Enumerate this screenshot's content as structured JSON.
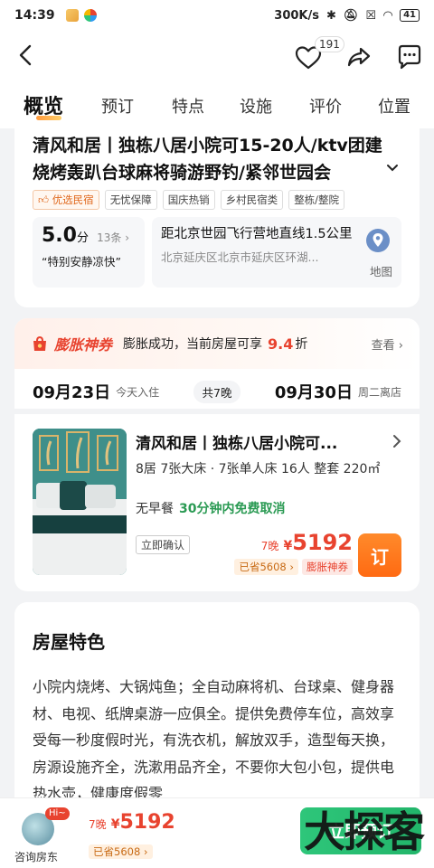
{
  "status": {
    "time": "14:39",
    "speed": "300K/s",
    "battery": "41"
  },
  "header": {
    "favorite_count": "191"
  },
  "tabs": [
    "概览",
    "预订",
    "特点",
    "设施",
    "评价",
    "位置"
  ],
  "listing": {
    "title": "清风和居丨独栋八居小院可15-20人/ktv团建烧烤轰趴台球麻将骑游野钓/紧邻世园会",
    "tags": [
      "优选民宿",
      "无忧保障",
      "国庆热销",
      "乡村民宿类",
      "整栋/整院"
    ],
    "rating": {
      "score": "5.0",
      "unit": "分",
      "count": "13条",
      "quote": "“特别安静凉快”"
    },
    "location": {
      "main": "距北京世园飞行营地直线1.5公里",
      "address": "北京延庆区北京市延庆区环湖...",
      "map_label": "地图"
    }
  },
  "coupon": {
    "name": "膨胀神券",
    "text": "膨胀成功，当前房屋可享",
    "rate": "9.4",
    "rate_unit": "折",
    "view_label": "查看"
  },
  "dates": {
    "checkin": "09月23日",
    "checkin_note": "今天入住",
    "nights": "共7晚",
    "checkout": "09月30日",
    "checkout_note": "周二离店"
  },
  "room": {
    "title": "清风和居丨独栋八居小院可...",
    "spec": "8居 7张大床 · 7张单人床 16人 整套 220㎡",
    "breakfast": "无早餐",
    "cancel": "30分钟内免费取消",
    "instant": "立即确认",
    "nights_label": "7晚",
    "currency": "¥",
    "price": "5192",
    "saved": "已省5608",
    "coupon_tag": "膨胀神券",
    "book": "订"
  },
  "features": {
    "title": "房屋特色",
    "body": "小院内烧烤、大锅炖鱼；全自动麻将机、台球桌、健身器材、电视、纸牌桌游一应俱全。提供免费停车位，高效享受每一秒度假时光，有洗衣机，解放双手，造型每天换，房源设施齐全，洗漱用品齐全，不要你大包小包，提供电热水壶，健康度假零"
  },
  "bottom": {
    "hi": "Hi~",
    "host_label": "咨询房东",
    "nights_label": "7晚",
    "currency": "¥",
    "price": "5192",
    "saved": "已省5608",
    "book": "立即预订"
  },
  "watermark": "大探客",
  "colors": {
    "accent_orange": "#ff6a12",
    "price_red": "#e8432f",
    "green": "#22b56a"
  }
}
